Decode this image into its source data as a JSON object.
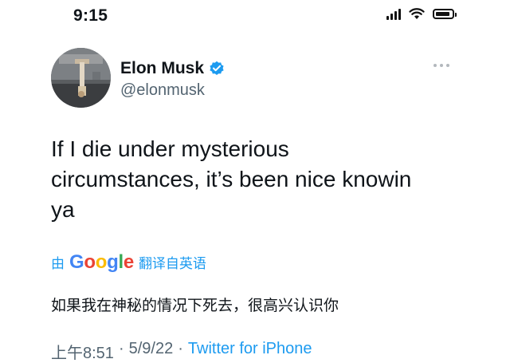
{
  "status_bar": {
    "time": "9:15"
  },
  "author": {
    "name": "Elon Musk",
    "handle": "@elonmusk",
    "verified": true
  },
  "tweet": {
    "lines": [
      "If I die under mysterious",
      "circumstances, it’s been nice knowin",
      "ya"
    ]
  },
  "translation": {
    "by_label": "由",
    "google_letters": [
      "G",
      "o",
      "o",
      "g",
      "l",
      "e"
    ],
    "google_colors": [
      "#4285F4",
      "#EA4335",
      "#FBBC05",
      "#4285F4",
      "#34A853",
      "#EA4335"
    ],
    "link_label": "翻译自英语",
    "text": "如果我在神秘的情况下死去，很高兴认识你"
  },
  "meta": {
    "time": "上午8:51",
    "separator": "·",
    "date": "5/9/22",
    "source": "Twitter for iPhone"
  },
  "colors": {
    "link": "#1d9bf0",
    "muted": "#536471",
    "verified": "#1d9bf0"
  }
}
